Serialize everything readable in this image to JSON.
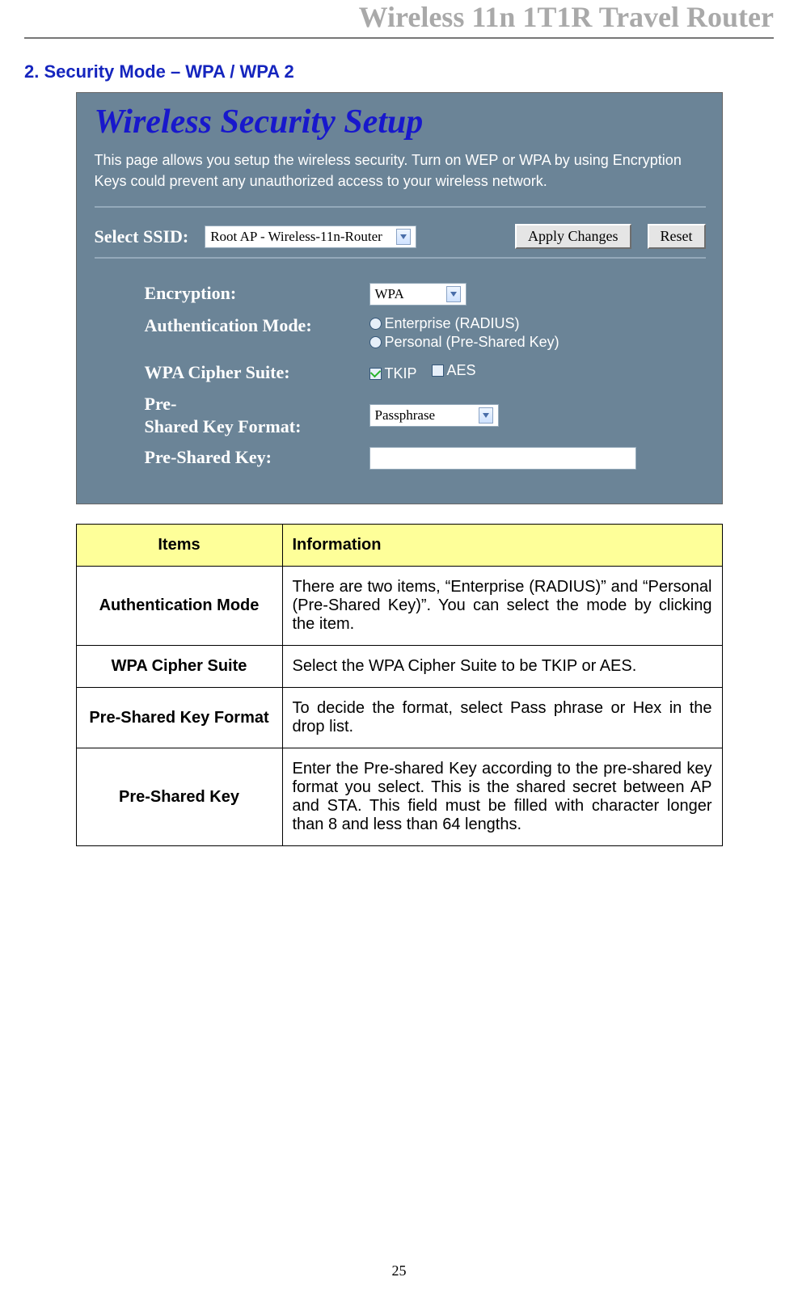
{
  "header": {
    "title": "Wireless 11n 1T1R Travel Router"
  },
  "section": {
    "heading": "2. Security Mode – WPA / WPA 2"
  },
  "panel": {
    "title": "Wireless Security Setup",
    "description": "This page allows you setup the wireless security. Turn on WEP or WPA by using Encryption Keys could prevent any unauthorized access to your wireless network.",
    "ssid_label": "Select SSID:",
    "ssid_select_value": "Root AP - Wireless-11n-Router",
    "apply_btn": "Apply Changes",
    "reset_btn": "Reset",
    "encryption_label": "Encryption:",
    "encryption_value": "WPA",
    "auth_label": "Authentication Mode:",
    "auth_opt1": "Enterprise (RADIUS)",
    "auth_opt2": "Personal (Pre-Shared Key)",
    "cipher_label": "WPA Cipher Suite:",
    "cipher_opt1": "TKIP",
    "cipher_opt2": "AES",
    "pskf_label_line1": "Pre-",
    "pskf_label_line2": "Shared Key Format:",
    "pskf_value": "Passphrase",
    "psk_label": "Pre-Shared Key:"
  },
  "table": {
    "head": {
      "c1": "Items",
      "c2": "Information"
    },
    "rows": [
      {
        "c1": "Authentication Mode",
        "c2": "There are two items, “Enterprise (RADIUS)” and “Personal (Pre-Shared Key)”. You can select the mode by clicking the item."
      },
      {
        "c1": "WPA Cipher Suite",
        "c2": "Select the WPA Cipher Suite to be TKIP or AES."
      },
      {
        "c1": "Pre-Shared Key Format",
        "c2": "To decide the format, select Pass phrase or Hex in the drop list."
      },
      {
        "c1": "Pre-Shared Key",
        "c2": "Enter the Pre-shared Key according to the pre-shared key format you select. This is the shared secret between AP and STA. This field must be filled with character longer than 8 and less than 64 lengths."
      }
    ]
  },
  "page_number": "25"
}
